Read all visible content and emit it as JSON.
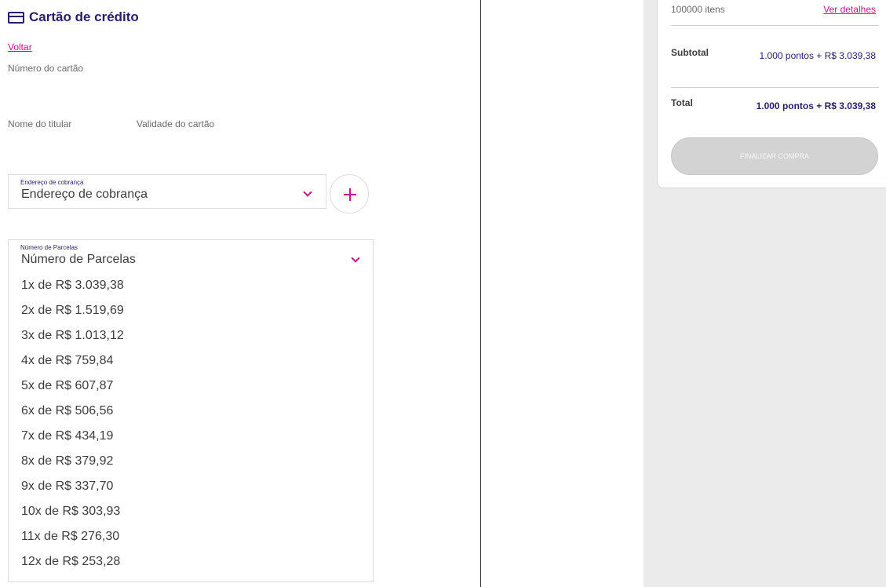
{
  "payment": {
    "title": "Cartão de crédito",
    "back_label": "Voltar",
    "card_number_label": "Número do cartão",
    "holder_name_label": "Nome do titular",
    "expiry_label": "Validade do cartão",
    "billing": {
      "float_label": "Endereço de cobrança",
      "value": "Endereço de cobrança"
    },
    "installments": {
      "float_label": "Número de Parcelas",
      "value": "Número de Parcelas",
      "options": [
        "1x de R$ 3.039,38",
        "2x de R$ 1.519,69",
        "3x de R$ 1.013,12",
        "4x de R$ 759,84",
        "5x de R$ 607,87",
        "6x de R$ 506,56",
        "7x de R$ 434,19",
        "8x de R$ 379,92",
        "9x de R$ 337,70",
        "10x de R$ 303,93",
        "11x de R$ 276,30",
        "12x de R$ 253,28"
      ]
    }
  },
  "summary": {
    "items_count": "100000 itens",
    "details_link": "Ver detalhes",
    "subtotal_label": "Subtotal",
    "subtotal_value": "1.000 pontos + R$ 3.039,38",
    "total_label": "Total",
    "total_value": "1.000 pontos + R$ 3.039,38",
    "finish_label": "FINALIZAR COMPRA"
  },
  "colors": {
    "accent": "#c8138b",
    "brand": "#2b1d6b",
    "panel_bg": "#ebebeb",
    "disabled_button": "#d3d3d3"
  }
}
